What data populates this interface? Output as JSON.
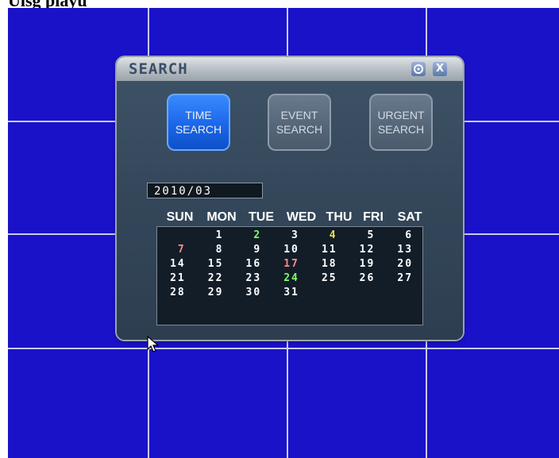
{
  "header_caption": "Ulsg playu",
  "dialog": {
    "title": "SEARCH",
    "settings_icon": "gear-icon",
    "close_label": "X",
    "buttons": {
      "time": {
        "line1": "TIME",
        "line2": "SEARCH",
        "state": "selected"
      },
      "event": {
        "line1": "EVENT",
        "line2": "SEARCH"
      },
      "urgent": {
        "line1": "URGENT",
        "line2": "SEARCH"
      }
    },
    "month": "2010/03",
    "weekdays": [
      "SUN",
      "MON",
      "TUE",
      "WED",
      "THU",
      "FRI",
      "SAT"
    ],
    "weeks": [
      [
        {
          "d": ""
        },
        {
          "d": "1"
        },
        {
          "d": "2",
          "c": "green"
        },
        {
          "d": "3"
        },
        {
          "d": "4",
          "c": "yellow"
        },
        {
          "d": "5"
        },
        {
          "d": "6"
        }
      ],
      [
        {
          "d": "7",
          "c": "red"
        },
        {
          "d": "8"
        },
        {
          "d": "9"
        },
        {
          "d": "10"
        },
        {
          "d": "11"
        },
        {
          "d": "12"
        },
        {
          "d": "13"
        }
      ],
      [
        {
          "d": "14"
        },
        {
          "d": "15"
        },
        {
          "d": "16"
        },
        {
          "d": "17",
          "c": "red"
        },
        {
          "d": "18"
        },
        {
          "d": "19"
        },
        {
          "d": "20"
        }
      ],
      [
        {
          "d": "21"
        },
        {
          "d": "22"
        },
        {
          "d": "23"
        },
        {
          "d": "24",
          "c": "green"
        },
        {
          "d": "25"
        },
        {
          "d": "26"
        },
        {
          "d": "27"
        }
      ],
      [
        {
          "d": "28"
        },
        {
          "d": "29"
        },
        {
          "d": "30"
        },
        {
          "d": "31"
        },
        {
          "d": ""
        },
        {
          "d": ""
        },
        {
          "d": ""
        }
      ]
    ]
  },
  "colors": {
    "screen_background": "#1a12c8",
    "active_button": "#1b66e8",
    "red_day": "#ff8a8a",
    "green_day": "#7fff6a",
    "yellow_day": "#e6e04a"
  }
}
